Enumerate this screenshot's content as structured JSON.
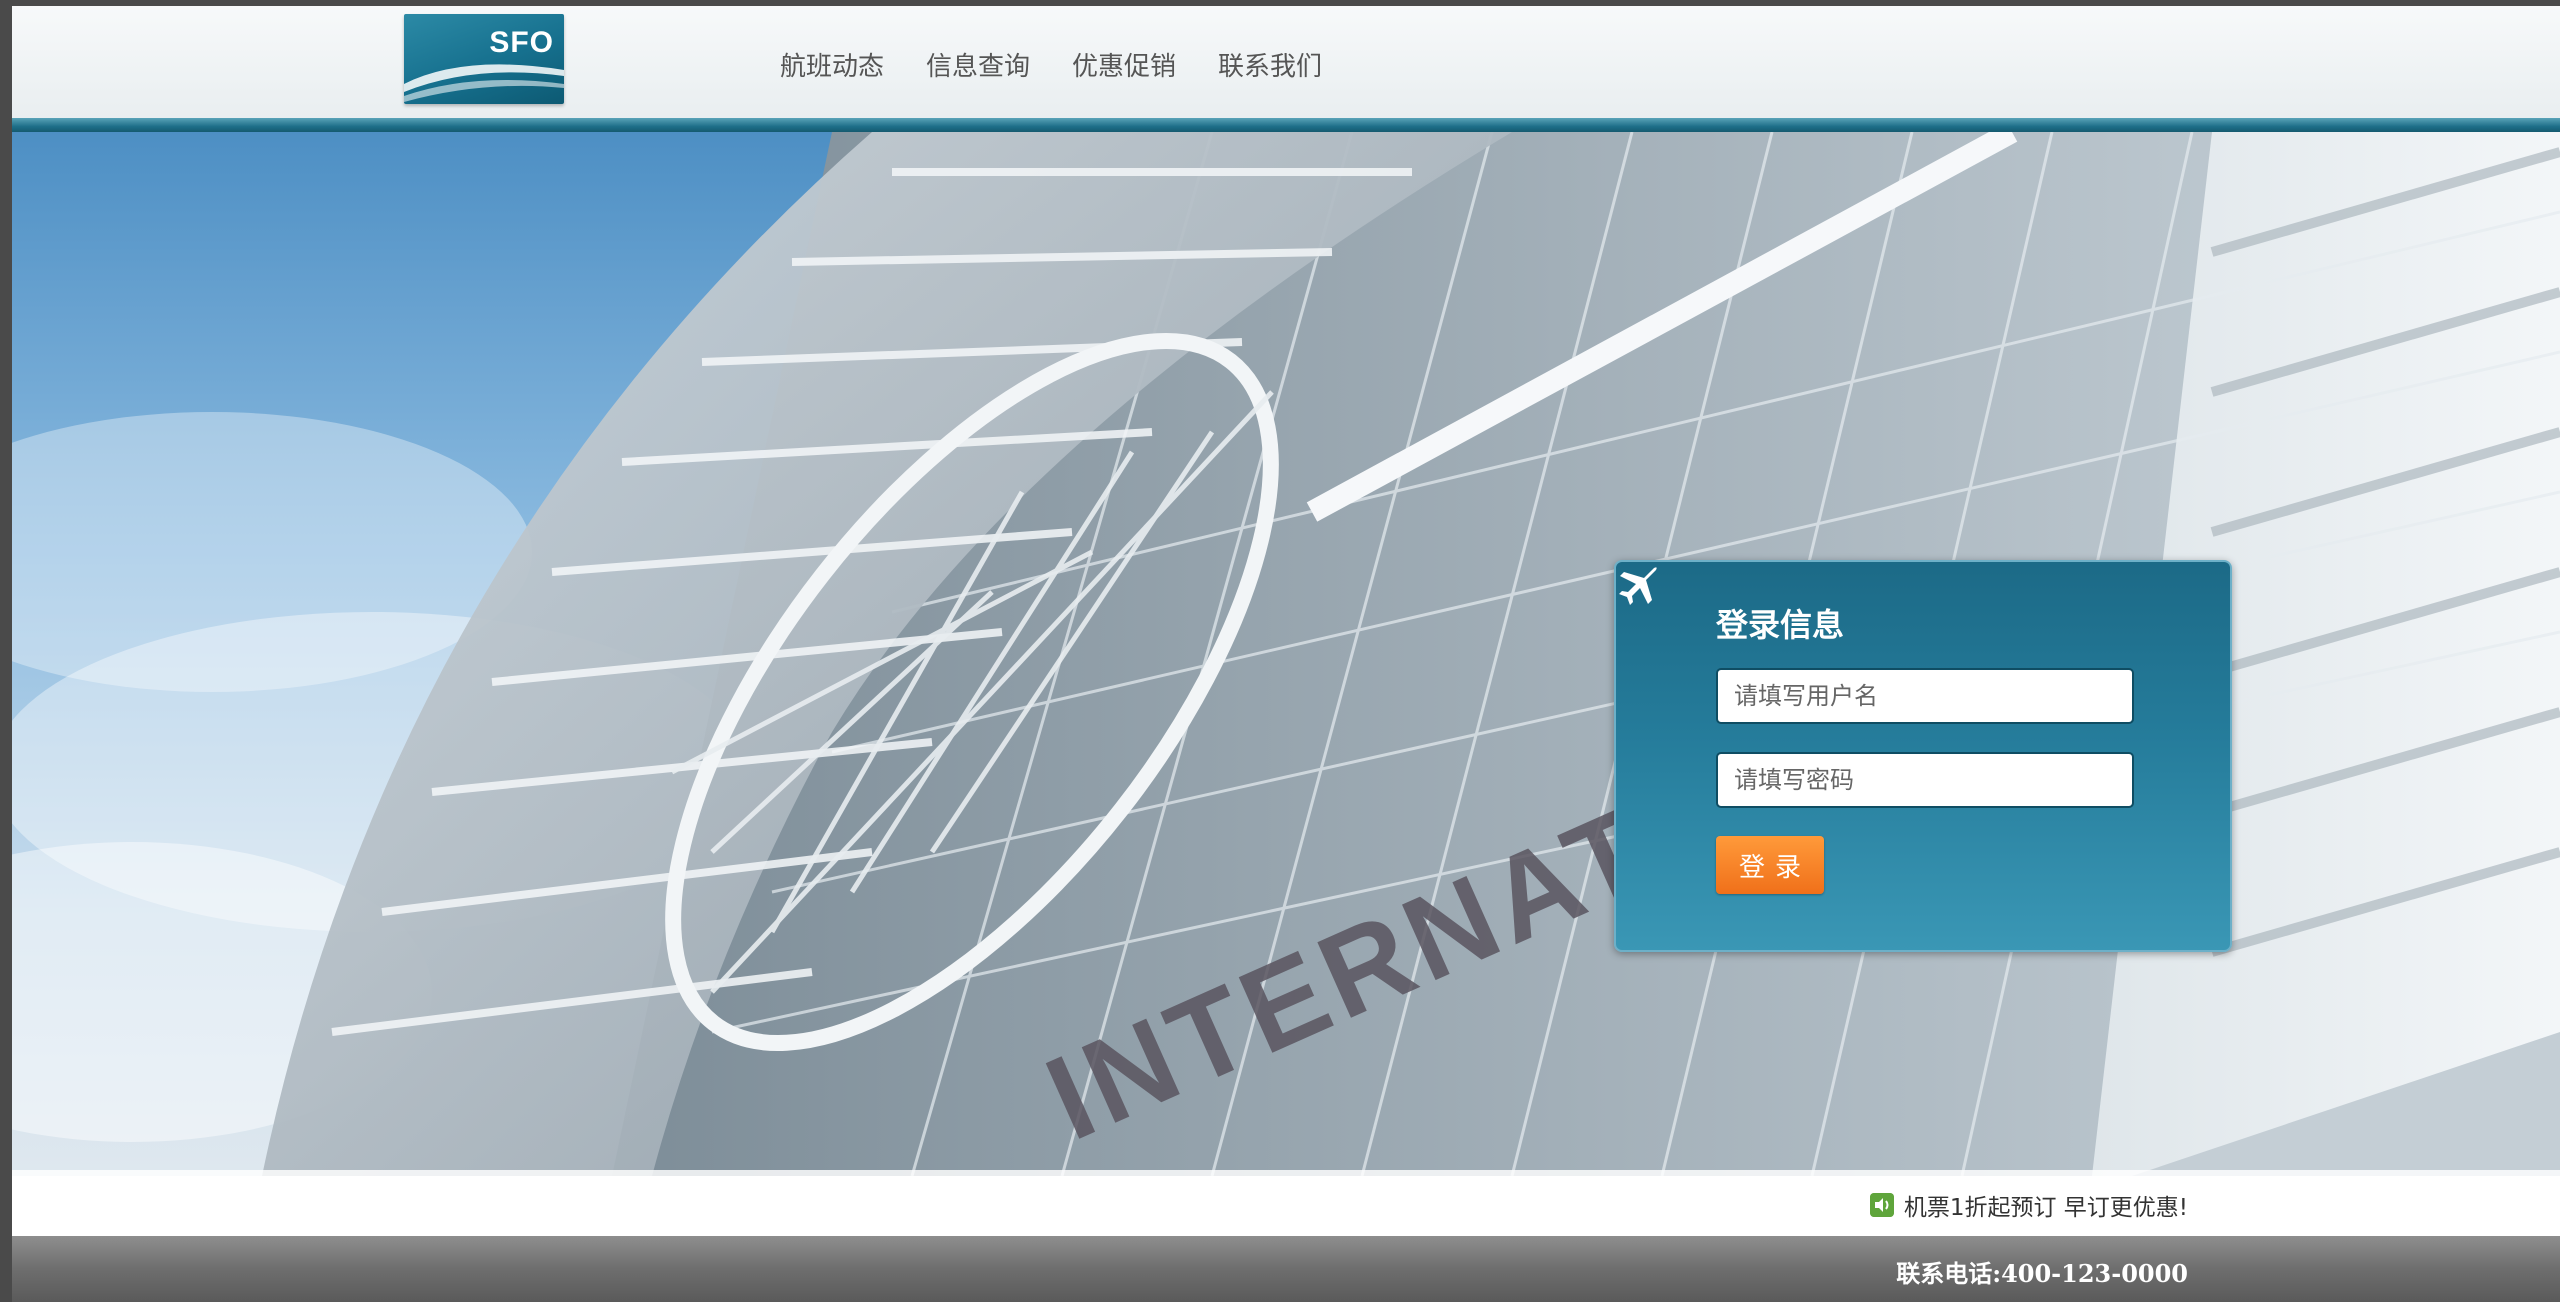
{
  "header": {
    "logo_text": "SFO",
    "nav": [
      {
        "label": "航班动态"
      },
      {
        "label": "信息查询"
      },
      {
        "label": "优惠促销"
      },
      {
        "label": "联系我们"
      }
    ]
  },
  "login": {
    "title": "登录信息",
    "username_placeholder": "请填写用户名",
    "password_placeholder": "请填写密码",
    "submit_label": "登录"
  },
  "promo": {
    "text": "机票1折起预订 早订更优惠!"
  },
  "footer": {
    "contact": "联系电话:400-123-0000"
  },
  "icons": {
    "logo": "sfo-logo",
    "login": "airplane-icon",
    "promo": "speaker-icon"
  },
  "colors": {
    "accent": "#1e6f89",
    "login_button": "#f37a22",
    "panel": "#257c9b"
  }
}
